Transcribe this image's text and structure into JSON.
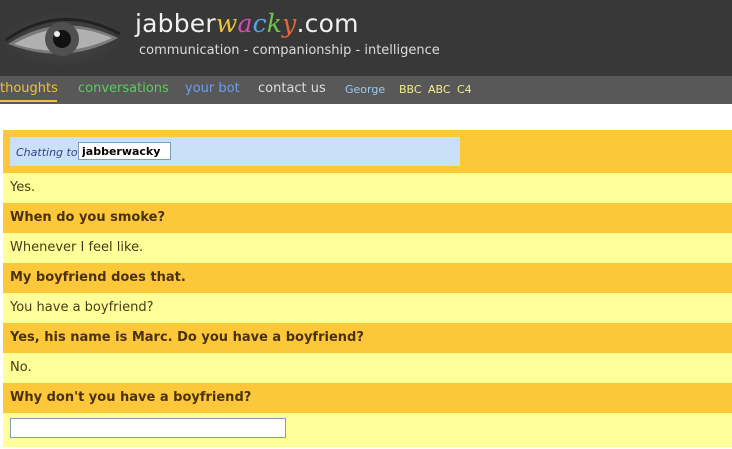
{
  "header": {
    "title_prefix": "jabber",
    "title_colored": [
      "w",
      "a",
      "c",
      "k",
      "y"
    ],
    "title_suffix": ".com",
    "tagline": "communication - companionship - intelligence"
  },
  "nav": {
    "thoughts": "thoughts",
    "conversations": "conversations",
    "your_bot": "your bot",
    "contact_us": "contact us",
    "george": "George",
    "bbc": "BBC",
    "abc": "ABC",
    "c4": "C4"
  },
  "colors": {
    "header_bg": "#383838",
    "nav_bg": "#585858",
    "user_row": "#fcc83a",
    "bot_row": "#ffff99",
    "chatbox_bg": "#c9e0f8"
  },
  "chat": {
    "chatting_to_label": "Chatting to",
    "bot_name": "jabberwacky",
    "messages": [
      {
        "speaker": "bot",
        "text": "Yes."
      },
      {
        "speaker": "user",
        "text": "When do you smoke?"
      },
      {
        "speaker": "bot",
        "text": "Whenever I feel like."
      },
      {
        "speaker": "user",
        "text": "My boyfriend does that."
      },
      {
        "speaker": "bot",
        "text": "You have a boyfriend?"
      },
      {
        "speaker": "user",
        "text": "Yes, his name is Marc. Do you have a boyfriend?"
      },
      {
        "speaker": "bot",
        "text": "No."
      },
      {
        "speaker": "user",
        "text": "Why don't you have a boyfriend?"
      }
    ],
    "input_value": ""
  }
}
